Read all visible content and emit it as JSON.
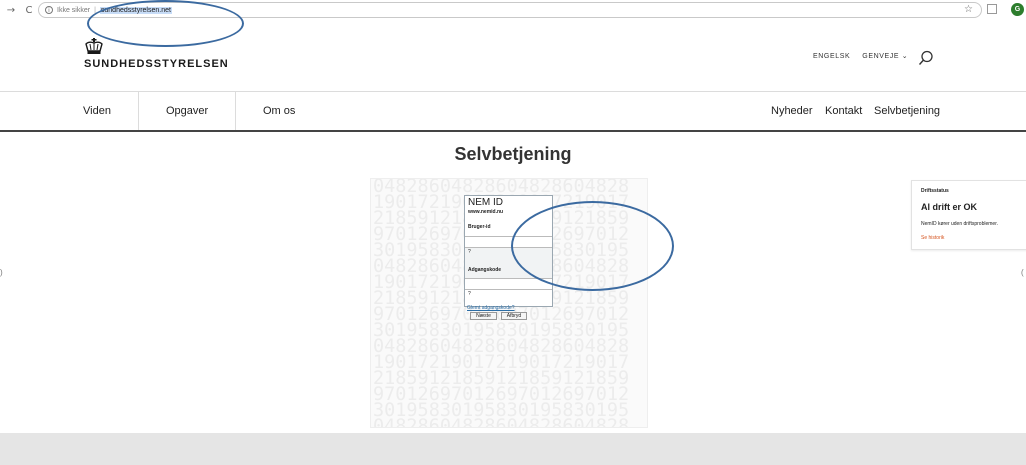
{
  "browser": {
    "back": "→",
    "reload": "C",
    "info": "i",
    "security": "Ikke sikker",
    "separator": "|",
    "url": "sundhedsstyrelsen.net",
    "star": "☆",
    "profile_initial": "G"
  },
  "header": {
    "logo_text": "SUNDHEDSSTYRELSEN",
    "utility": [
      "ENGELSK",
      "GENVEJE ⌄"
    ]
  },
  "nav": {
    "main": [
      "Viden",
      "Opgaver",
      "Om os"
    ],
    "secondary": [
      "Nyheder",
      "Kontakt",
      "Selvbetjening"
    ]
  },
  "page": {
    "title": "Selvbetjening"
  },
  "nemid": {
    "logo": "NEM ID",
    "site": "www.nemid.nu",
    "user_label": "Bruger-id",
    "hint1": "?",
    "password_label": "Adgangskode",
    "hint2": "?",
    "forgot": "Glemt adgangskode?",
    "next": "Næste",
    "cancel": "Afbryd",
    "bg_digits": "04828604828604828604828\n19017219017219017219017\n21859121859121859121859\n97012697012697012697012\n30195830195830195830195\n04828604828604828604828\n19017219017219017219017\n21859121859121859121859\n97012697012697012697012\n30195830195830195830195\n04828604828604828604828\n19017219017219017219017\n21859121859121859121859\n97012697012697012697012\n30195830195830195830195\n04828604828604828604828"
  },
  "status": {
    "heading": "Driftsstatus",
    "title": "Al drift er OK",
    "desc": "NemID kører uden driftsproblemer.",
    "link": "Se historik"
  },
  "edges": {
    "left": ")",
    "right": "("
  },
  "colors": {
    "annotation": "#3b6aa0",
    "link_orange": "#d5541f",
    "avatar_green": "#2d7d2d"
  }
}
